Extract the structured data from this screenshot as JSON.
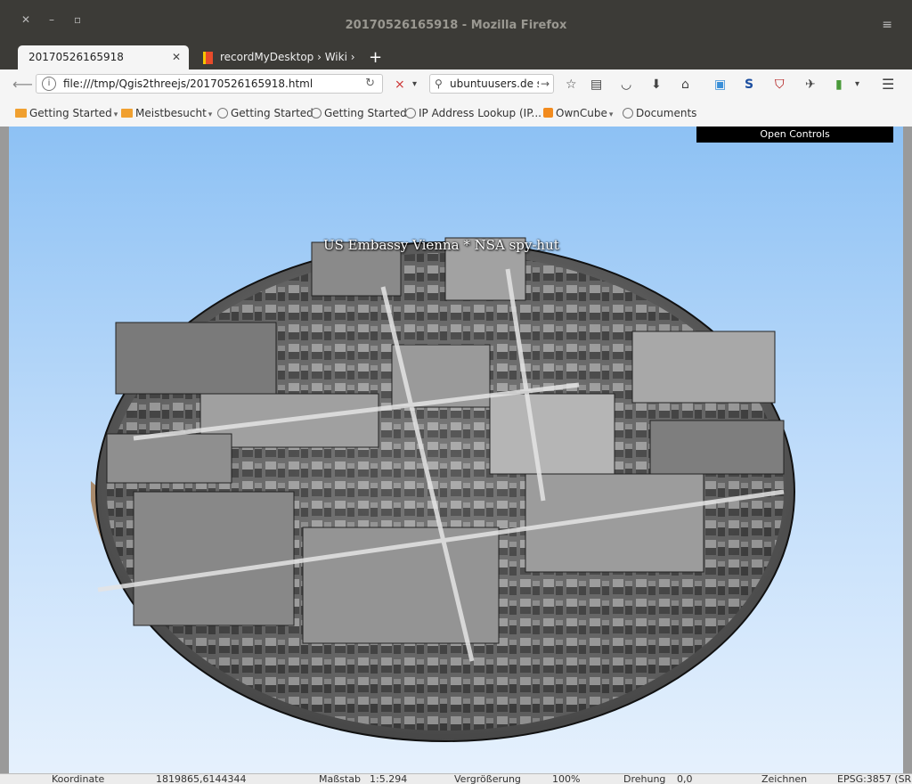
{
  "window": {
    "title": "20170526165918 - Mozilla Firefox"
  },
  "tabs": [
    {
      "label": "20170526165918",
      "active": true
    },
    {
      "label": "recordMyDesktop › Wiki ›",
      "active": false
    }
  ],
  "navbar": {
    "url": "file:///tmp/Qgis2threejs/20170526165918.html",
    "search_value": "ubuntuusers.de scre"
  },
  "bookmarks": [
    {
      "label": "Getting Started",
      "icon": "folder-icon",
      "dropdown": true
    },
    {
      "label": "Meistbesucht",
      "icon": "folder-icon",
      "dropdown": true
    },
    {
      "label": "Getting Started",
      "icon": "globe-icon",
      "dropdown": false
    },
    {
      "label": "Getting Started",
      "icon": "globe-icon",
      "dropdown": false
    },
    {
      "label": "IP Address Lookup (IP...",
      "icon": "globe-icon",
      "dropdown": false
    },
    {
      "label": "OwnCube",
      "icon": "rss-icon",
      "dropdown": true
    },
    {
      "label": "Documents",
      "icon": "globe-icon",
      "dropdown": false
    }
  ],
  "content": {
    "controls_button": "Open Controls",
    "scene_label": "US Embassy Vienna * NSA spy-hut"
  },
  "statusbar": {
    "koordinate_label": "Koordinate",
    "koordinate_value": "1819865,6144344",
    "massstab_label": "Maßstab",
    "massstab_value": "1:5.294",
    "vergroesserung_label": "Vergrößerung",
    "vergroesserung_value": "100%",
    "drehung_label": "Drehung",
    "drehung_value": "0,0",
    "zeichnen_label": "Zeichnen",
    "crs_label": "EPSG:3857 (SR"
  },
  "colors": {
    "titlebar": "#3c3b37",
    "sky_top": "#8dc1f4",
    "sky_bottom": "#e6f1fd",
    "terrain_side": "#b89a7c",
    "terrain_top": "#6f6f6f"
  }
}
